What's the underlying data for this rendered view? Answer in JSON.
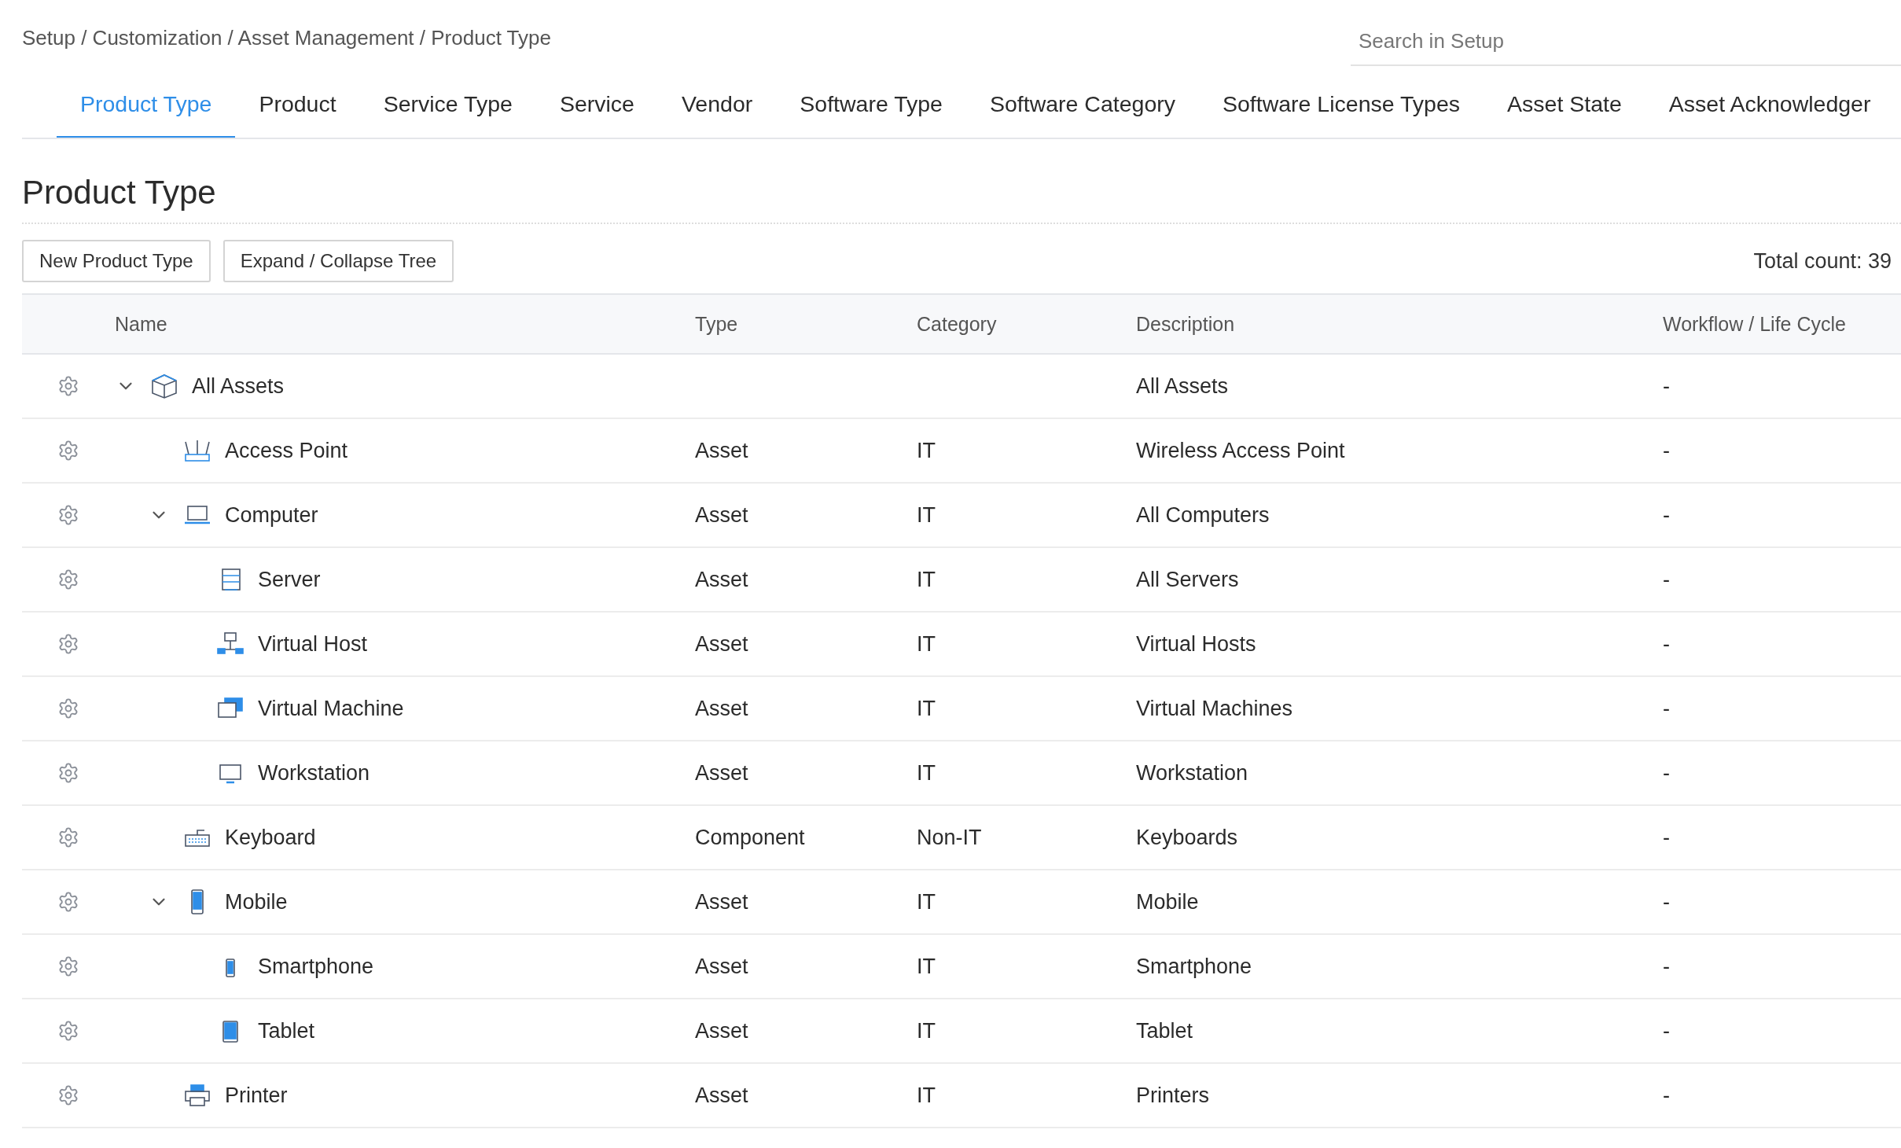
{
  "breadcrumb": "Setup / Customization / Asset Management / Product Type",
  "search": {
    "placeholder": "Search in Setup"
  },
  "tabs": [
    {
      "label": "Product Type",
      "selected": true
    },
    {
      "label": "Product",
      "selected": false
    },
    {
      "label": "Service Type",
      "selected": false
    },
    {
      "label": "Service",
      "selected": false
    },
    {
      "label": "Vendor",
      "selected": false
    },
    {
      "label": "Software Type",
      "selected": false
    },
    {
      "label": "Software Category",
      "selected": false
    },
    {
      "label": "Software License Types",
      "selected": false
    },
    {
      "label": "Asset State",
      "selected": false
    },
    {
      "label": "Asset Acknowledger",
      "selected": false
    }
  ],
  "page_title": "Product Type",
  "buttons": [
    "New Product Type",
    "Expand / Collapse Tree"
  ],
  "total_count": "Total count: 39",
  "table": {
    "columns": [
      "Name",
      "Type",
      "Category",
      "Description",
      "Workflow / Life Cycle"
    ],
    "rows": [
      {
        "kind": "box",
        "name": "All Assets",
        "type": "",
        "category": "",
        "description": "All Assets",
        "workflow": "-",
        "expanded": true,
        "children": [
          {
            "kind": "router",
            "name": "Access Point",
            "type": "Asset",
            "category": "IT",
            "description": "Wireless Access Point",
            "workflow": "-"
          },
          {
            "kind": "laptop",
            "name": "Computer",
            "type": "Asset",
            "category": "IT",
            "description": "All Computers",
            "workflow": "-",
            "expanded": true,
            "children": [
              {
                "kind": "server",
                "name": "Server",
                "type": "Asset",
                "category": "IT",
                "description": "All Servers",
                "workflow": "-"
              },
              {
                "kind": "network",
                "name": "Virtual Host",
                "type": "Asset",
                "category": "IT",
                "description": "Virtual Hosts",
                "workflow": "-"
              },
              {
                "kind": "windows",
                "name": "Virtual Machine",
                "type": "Asset",
                "category": "IT",
                "description": "Virtual Machines",
                "workflow": "-"
              },
              {
                "kind": "monitor",
                "name": "Workstation",
                "type": "Asset",
                "category": "IT",
                "description": "Workstation",
                "workflow": "-"
              }
            ]
          },
          {
            "kind": "keyboard",
            "name": "Keyboard",
            "type": "Component",
            "category": "Non-IT",
            "description": "Keyboards",
            "workflow": "-"
          },
          {
            "kind": "phone",
            "name": "Mobile",
            "type": "Asset",
            "category": "IT",
            "description": "Mobile",
            "workflow": "-",
            "expanded": true,
            "children": [
              {
                "kind": "smallphone",
                "name": "Smartphone",
                "type": "Asset",
                "category": "IT",
                "description": "Smartphone",
                "workflow": "-"
              },
              {
                "kind": "tablet",
                "name": "Tablet",
                "type": "Asset",
                "category": "IT",
                "description": "Tablet",
                "workflow": "-"
              }
            ]
          },
          {
            "kind": "printer",
            "name": "Printer",
            "type": "Asset",
            "category": "IT",
            "description": "Printers",
            "workflow": "-"
          }
        ]
      }
    ]
  }
}
